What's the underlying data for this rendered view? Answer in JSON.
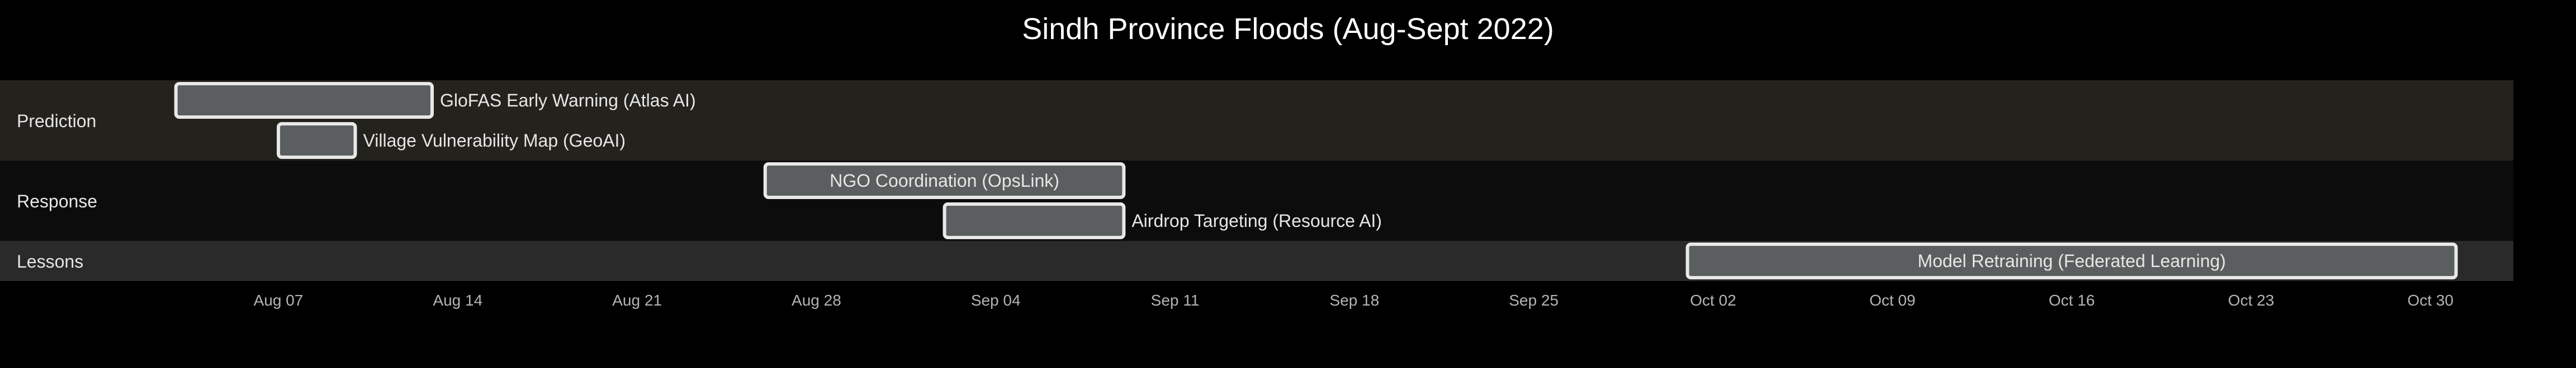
{
  "chart_data": {
    "type": "gantt",
    "title": "Sindh Province Floods (Aug-Sept 2022)",
    "x_axis": {
      "type": "date",
      "range": [
        "2022-08-02",
        "2022-11-02"
      ],
      "ticks": [
        {
          "date": "2022-08-07",
          "label": "Aug 07"
        },
        {
          "date": "2022-08-14",
          "label": "Aug 14"
        },
        {
          "date": "2022-08-21",
          "label": "Aug 21"
        },
        {
          "date": "2022-08-28",
          "label": "Aug 28"
        },
        {
          "date": "2022-09-04",
          "label": "Sep 04"
        },
        {
          "date": "2022-09-11",
          "label": "Sep 11"
        },
        {
          "date": "2022-09-18",
          "label": "Sep 18"
        },
        {
          "date": "2022-09-25",
          "label": "Sep 25"
        },
        {
          "date": "2022-10-02",
          "label": "Oct 02"
        },
        {
          "date": "2022-10-09",
          "label": "Oct 09"
        },
        {
          "date": "2022-10-16",
          "label": "Oct 16"
        },
        {
          "date": "2022-10-23",
          "label": "Oct 23"
        },
        {
          "date": "2022-10-30",
          "label": "Oct 30"
        }
      ]
    },
    "sections": [
      {
        "name": "Prediction",
        "color": "#24221c",
        "tasks": [
          {
            "name": "GloFAS Early Warning (Atlas AI)",
            "start": "2022-08-03",
            "end": "2022-08-13",
            "label_position": "outside"
          },
          {
            "name": "Village Vulnerability Map (GeoAI)",
            "start": "2022-08-07",
            "end": "2022-08-10",
            "label_position": "outside"
          }
        ]
      },
      {
        "name": "Response",
        "color": "#0c0c0c",
        "tasks": [
          {
            "name": "NGO Coordination (OpsLink)",
            "start": "2022-08-26",
            "end": "2022-09-09",
            "label_position": "inside"
          },
          {
            "name": "Airdrop Targeting (Resource AI)",
            "start": "2022-09-02",
            "end": "2022-09-09",
            "label_position": "outside"
          }
        ]
      },
      {
        "name": "Lessons",
        "color": "#2a2a2a",
        "tasks": [
          {
            "name": "Model Retraining (Federated Learning)",
            "start": "2022-10-01",
            "end": "2022-10-31",
            "label_position": "inside"
          }
        ]
      }
    ],
    "colors": {
      "background": "#000000",
      "bar_fill": "#5b5e5e",
      "bar_stroke": "#e8e8e8",
      "text": "#e6e6e6",
      "tick_text": "#b4b4b4"
    }
  }
}
